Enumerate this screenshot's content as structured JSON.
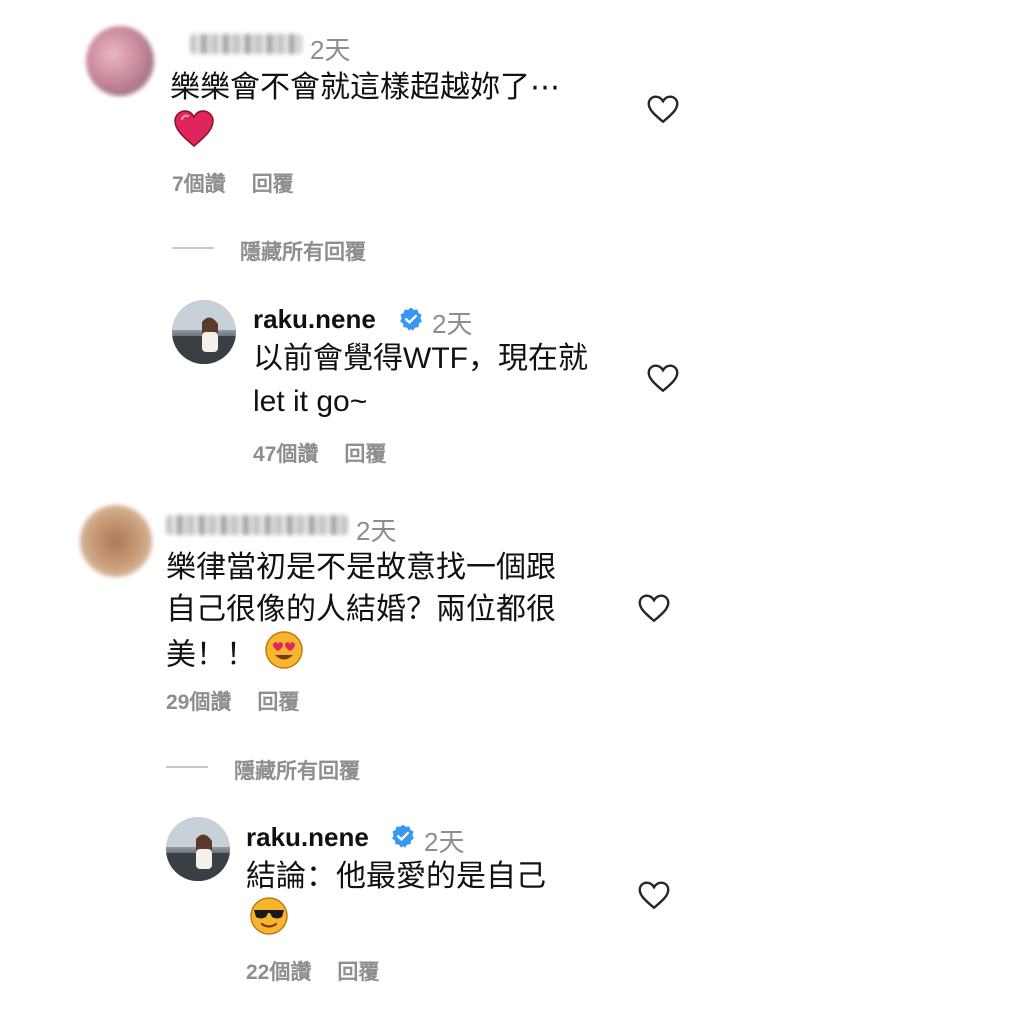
{
  "comments": [
    {
      "time": "2天",
      "text_line1": "樂樂會不會就這樣超越妳了⋯",
      "likes": "7個讚",
      "reply": "回覆",
      "hide_replies": "隱藏所有回覆",
      "emoji": "red-heart-emoji"
    },
    {
      "time": "2天",
      "text_line1": "樂律當初是不是故意找一個跟",
      "text_line2": "自己很像的人結婚？兩位都很",
      "text_line3": "美！！",
      "likes": "29個讚",
      "reply": "回覆",
      "hide_replies": "隱藏所有回覆",
      "emoji": "heart-eyes-emoji"
    }
  ],
  "replies": [
    {
      "username": "raku.nene",
      "time": "2天",
      "text_line1": "以前會覺得WTF，現在就",
      "text_line2": "let it go~",
      "likes": "47個讚",
      "reply": "回覆",
      "verified": true
    },
    {
      "username": "raku.nene",
      "time": "2天",
      "text_line1": "結論：他最愛的是自己",
      "likes": "22個讚",
      "reply": "回覆",
      "verified": true,
      "emoji": "sunglasses-emoji"
    }
  ],
  "colors": {
    "text": "#111111",
    "meta": "#8e8e8e",
    "verified": "#3897f0",
    "heart_red": "#e0245e"
  }
}
